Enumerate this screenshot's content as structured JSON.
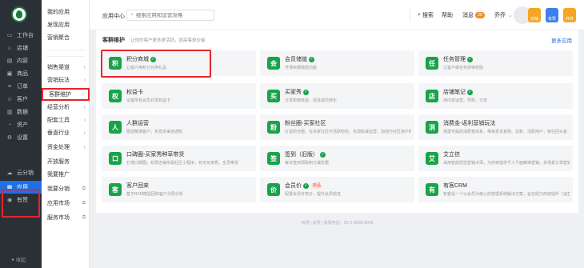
{
  "sidebar": {
    "items": [
      {
        "icon": "workbench-icon",
        "glyph": "▭",
        "label": "工作台"
      },
      {
        "icon": "store-icon",
        "glyph": "⌂",
        "label": "店铺"
      },
      {
        "icon": "content-icon",
        "glyph": "▤",
        "label": "内容"
      },
      {
        "icon": "goods-icon",
        "glyph": "▣",
        "label": "商品"
      },
      {
        "icon": "order-icon",
        "glyph": "≡",
        "label": "订单"
      },
      {
        "icon": "customer-icon",
        "glyph": "☺",
        "label": "客户"
      },
      {
        "icon": "data-icon",
        "glyph": "▥",
        "label": "数据"
      },
      {
        "icon": "assets-icon",
        "glyph": "◔",
        "label": "资产"
      },
      {
        "icon": "settings-icon",
        "glyph": "⚙",
        "label": "设置"
      },
      {
        "icon": "cloud-distribution-icon",
        "glyph": "☁",
        "label": "云分销"
      },
      {
        "icon": "apps-icon",
        "glyph": "▦",
        "label": "应用"
      },
      {
        "icon": "youzan-icon",
        "glyph": "◉",
        "label": "有赞"
      }
    ],
    "bottom_label": "收起",
    "bottom_glyph": "◂"
  },
  "subnav": {
    "items": [
      {
        "label": "我的应用",
        "arrow": "",
        "ext": ""
      },
      {
        "label": "发现应用",
        "arrow": "",
        "ext": ""
      },
      {
        "label": "营销聚合",
        "arrow": "",
        "ext": ""
      },
      {
        "label": "销售渠道",
        "arrow": "›",
        "ext": ""
      },
      {
        "label": "营销玩法",
        "arrow": "›",
        "ext": ""
      },
      {
        "label": "客群维护",
        "arrow": "›",
        "ext": ""
      },
      {
        "label": "经营分析",
        "arrow": "›",
        "ext": ""
      },
      {
        "label": "配套工具",
        "arrow": "›",
        "ext": ""
      },
      {
        "label": "垂直行业",
        "arrow": "›",
        "ext": ""
      },
      {
        "label": "资金处理",
        "arrow": "›",
        "ext": ""
      },
      {
        "label": "开放服务",
        "arrow": "",
        "ext": ""
      },
      {
        "label": "我要推广",
        "arrow": "",
        "ext": ""
      },
      {
        "label": "我要分销",
        "arrow": "",
        "ext": "⧉"
      },
      {
        "label": "应用市场",
        "arrow": "",
        "ext": "⧉"
      },
      {
        "label": "服务市场",
        "arrow": "",
        "ext": "⧉"
      }
    ]
  },
  "topbar": {
    "title": "应用中心",
    "search_placeholder": "搜索应用和运营攻略",
    "search_label": "搜索",
    "help_label": "帮助",
    "message_label": "消息",
    "message_count": "20",
    "user_label": "乔乔",
    "user_caret": "⌄",
    "apps": [
      {
        "label": "店铺",
        "color": "#f5a623"
      },
      {
        "label": "有赞",
        "color": "#3b7ff0"
      },
      {
        "label": "乔乔",
        "color": "#f5a623"
      }
    ]
  },
  "panel": {
    "heading": "客群维护",
    "subheading": "让你的客户更多更活跃，提高客单价能",
    "more_link": "更多应用",
    "cards": [
      {
        "icon": "积",
        "title": "积分商城",
        "verified": true,
        "is_new": false,
        "desc": "让客户用积分兑换礼品"
      },
      {
        "icon": "会",
        "title": "会员储值",
        "verified": true,
        "is_new": false,
        "desc": "开通余额储值功能"
      },
      {
        "icon": "任",
        "title": "任务管理",
        "verified": true,
        "is_new": false,
        "desc": "让客户做任务获得奖励"
      },
      {
        "icon": "权",
        "title": "权益卡",
        "verified": false,
        "is_new": false,
        "desc": "设置所有会员共享权益卡"
      },
      {
        "icon": "买",
        "title": "买家秀",
        "verified": true,
        "is_new": false,
        "desc": "分享购物体验，促进成交转化"
      },
      {
        "icon": "店",
        "title": "店铺笔记",
        "verified": true,
        "is_new": false,
        "desc": "用内容运营、导购、分享"
      },
      {
        "icon": "人",
        "title": "人群运营",
        "verified": false,
        "is_new": false,
        "desc": "圈选精准客户，实现多渠道通知"
      },
      {
        "icon": "粉",
        "title": "粉丝圈-买家社区",
        "verified": false,
        "is_new": false,
        "desc": "打造粉丝圈，在买家社区中活跃粉丝，实现私域运营，加强与社区用户的互动"
      },
      {
        "icon": "消",
        "title": "消费金-返利营销玩法",
        "verified": false,
        "is_new": false,
        "desc": "搭建专属的消费金体系，带来更多复购、拉新、活跃用户，锁住回头客"
      },
      {
        "icon": "口",
        "title": "口碑圈-买家秀种草带货",
        "verified": false,
        "is_new": false,
        "desc": "打通口碑圈，有赞店铺专属社区小程序，有买买家秀、全员带货"
      },
      {
        "icon": "签",
        "title": "签到（旧版）",
        "verified": true,
        "is_new": false,
        "desc": "每日签到领取积分或优惠"
      },
      {
        "icon": "艾",
        "title": "艾立信",
        "verified": false,
        "is_new": false,
        "desc": "采用智能短信营销大师，为商家提供千人千面精准营销，多场景订单营销"
      },
      {
        "icon": "客",
        "title": "客户回来",
        "verified": false,
        "is_new": false,
        "desc": "基于RFM模型回购客户分层分析"
      },
      {
        "icon": "价",
        "title": "会员价",
        "verified": true,
        "is_new": true,
        "new_label": "新品",
        "desc": "配置会员专享价，提升会员粘性"
      },
      {
        "icon": "有",
        "title": "有客CRM",
        "verified": false,
        "is_new": false,
        "desc": "有客是一个以会员为核心的管理系统解决方案，旨在助力商家提升（运营）的效果"
      }
    ]
  },
  "footer": "有赞 | 有赞 | 客服电话：0571-8898-8848",
  "colors": {
    "accent": "#1f6fe5",
    "brand_green": "#18a34a",
    "highlight_red": "#e5252a",
    "sidebar_bg": "#2b2f36"
  }
}
